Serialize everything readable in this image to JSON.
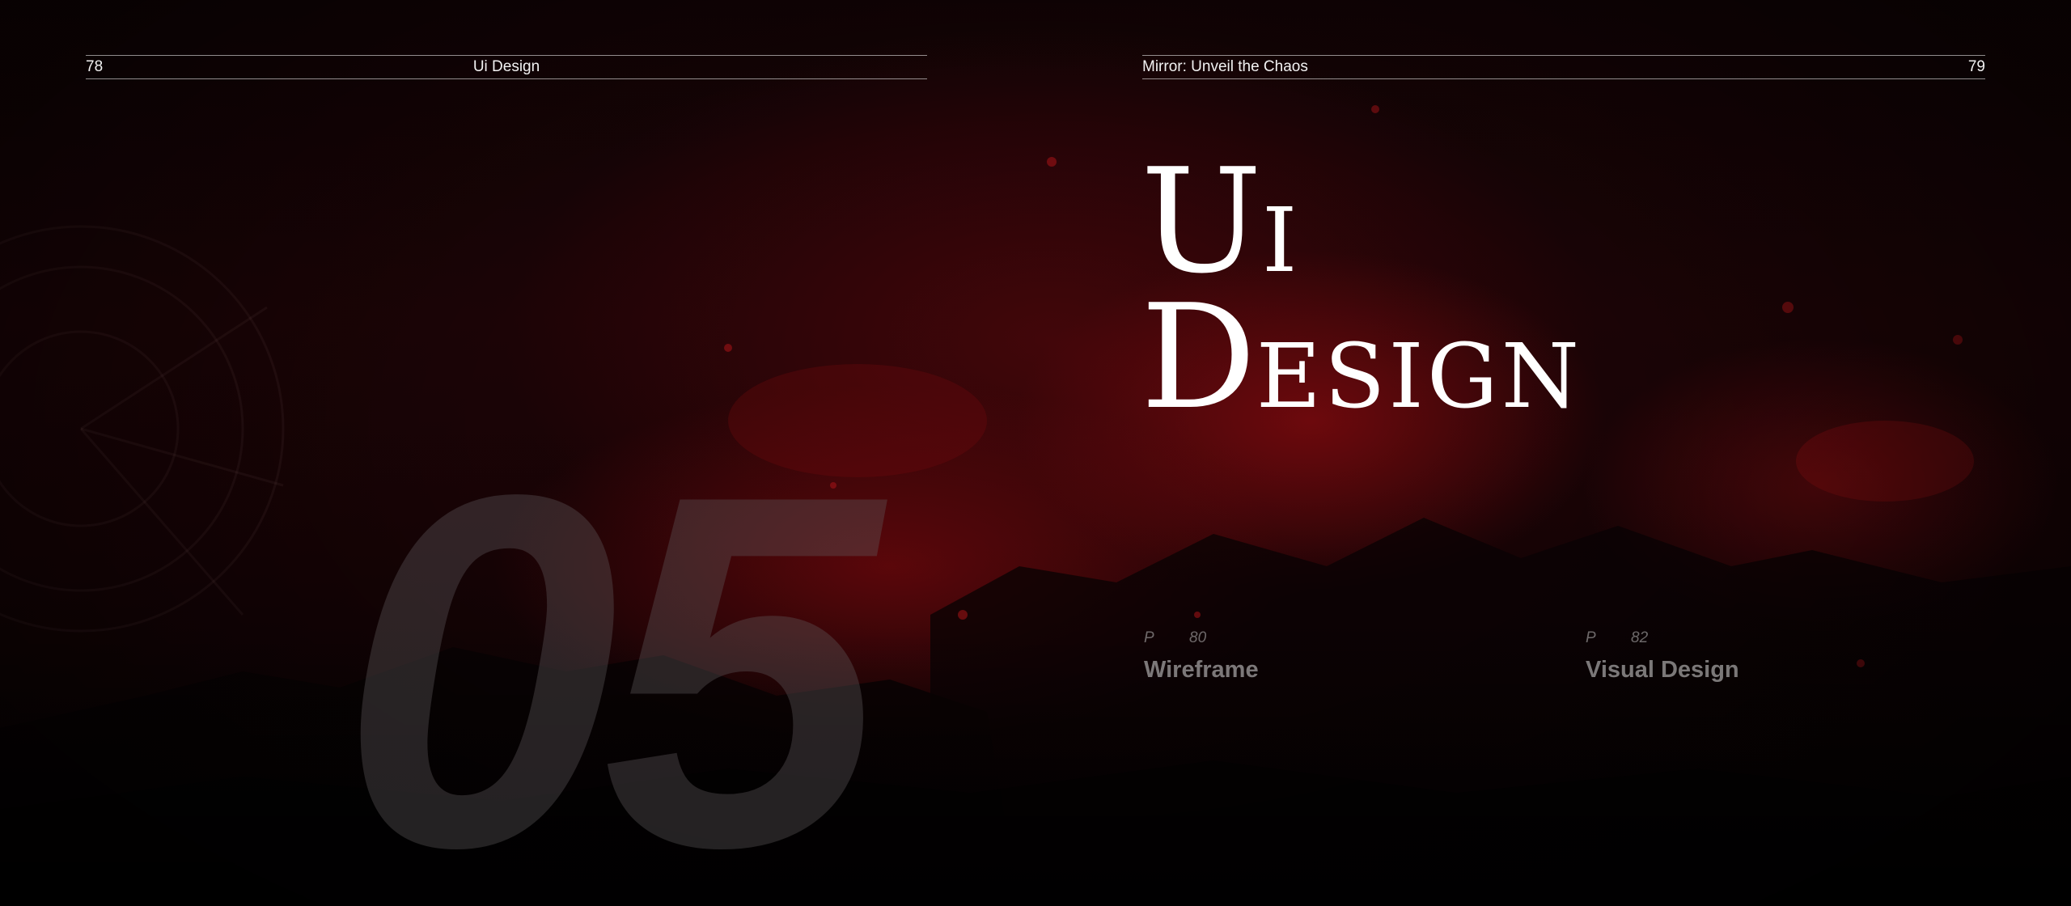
{
  "spread": {
    "left_page": {
      "page_number": "78",
      "running_title": "Ui Design",
      "chapter_number": "05"
    },
    "right_page": {
      "running_title": "Mirror: Unveil the Chaos",
      "page_number": "79",
      "title": {
        "line1_cap": "U",
        "line1_rest": "I",
        "line2_cap": "D",
        "line2_rest": "ESIGN"
      },
      "sections": [
        {
          "prefix": "P",
          "page": "80",
          "name": "Wireframe"
        },
        {
          "prefix": "P",
          "page": "82",
          "name": "Visual Design"
        }
      ]
    }
  },
  "colors": {
    "background": "#120305",
    "glow_red": "#780a0e",
    "text": "#ffffff",
    "muted_text": "#9a9a9a"
  }
}
